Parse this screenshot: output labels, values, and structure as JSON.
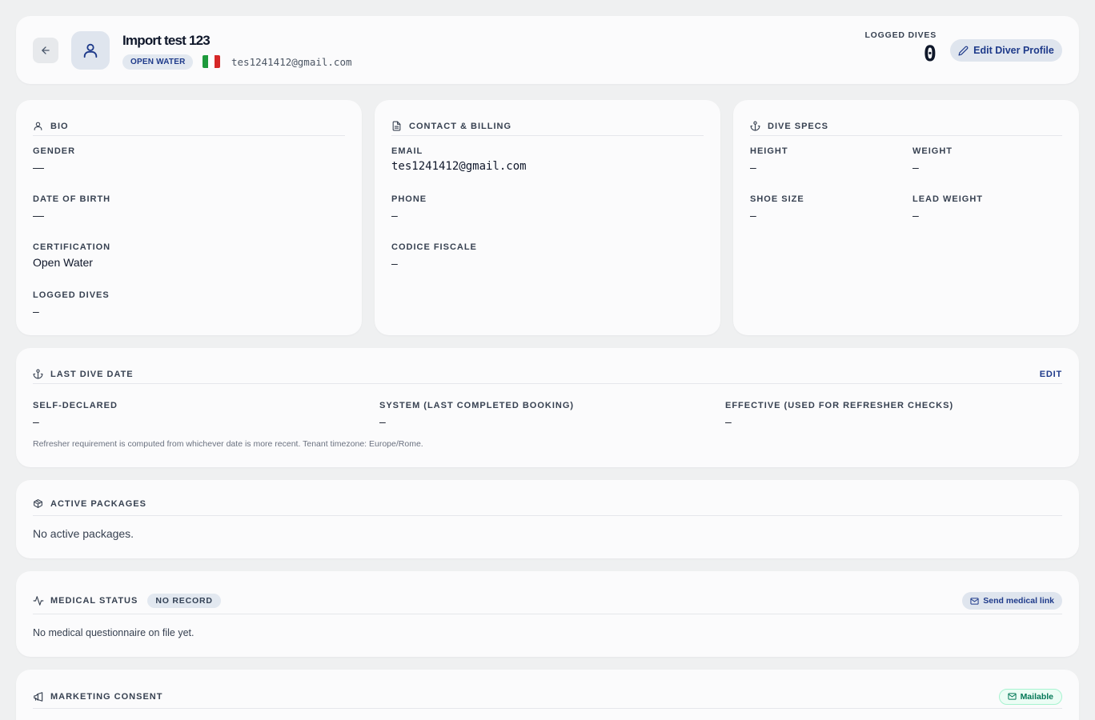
{
  "header": {
    "name": "Import test 123",
    "cert_badge": "OPEN WATER",
    "email": "tes1241412@gmail.com",
    "logged_dives_label": "LOGGED DIVES",
    "logged_dives_value": "0",
    "edit_button": "Edit Diver Profile"
  },
  "bio": {
    "title": "BIO",
    "fields": [
      {
        "label": "GENDER",
        "value": "—"
      },
      {
        "label": "DATE OF BIRTH",
        "value": "—"
      },
      {
        "label": "CERTIFICATION",
        "value": "Open Water"
      },
      {
        "label": "LOGGED DIVES",
        "value": "–"
      }
    ]
  },
  "contact": {
    "title": "CONTACT & BILLING",
    "fields": [
      {
        "label": "EMAIL",
        "value": "tes1241412@gmail.com"
      },
      {
        "label": "PHONE",
        "value": "–"
      },
      {
        "label": "CODICE FISCALE",
        "value": "–"
      }
    ]
  },
  "specs": {
    "title": "DIVE SPECS",
    "fields": [
      {
        "label": "HEIGHT",
        "value": "–"
      },
      {
        "label": "WEIGHT",
        "value": "–"
      },
      {
        "label": "SHOE SIZE",
        "value": "–"
      },
      {
        "label": "LEAD WEIGHT",
        "value": "–"
      }
    ]
  },
  "last_dive": {
    "title": "LAST DIVE DATE",
    "edit": "EDIT",
    "fields": [
      {
        "label": "SELF-DECLARED",
        "value": "–"
      },
      {
        "label": "SYSTEM (LAST COMPLETED BOOKING)",
        "value": "–"
      },
      {
        "label": "EFFECTIVE (USED FOR REFRESHER CHECKS)",
        "value": "–"
      }
    ],
    "note": "Refresher requirement is computed from whichever date is more recent. Tenant timezone: Europe/Rome."
  },
  "packages": {
    "title": "ACTIVE PACKAGES",
    "empty": "No active packages."
  },
  "medical": {
    "title": "MEDICAL STATUS",
    "badge": "NO RECORD",
    "button": "Send medical link",
    "empty": "No medical questionnaire on file yet."
  },
  "marketing": {
    "title": "MARKETING CONSENT",
    "badge": "Mailable"
  },
  "colors": {
    "accent": "#1e3a8a",
    "badge_bg": "#e2e8f0",
    "mailable_green": "#047857",
    "flag_green": "#1e9a3c",
    "flag_red": "#d62828"
  }
}
